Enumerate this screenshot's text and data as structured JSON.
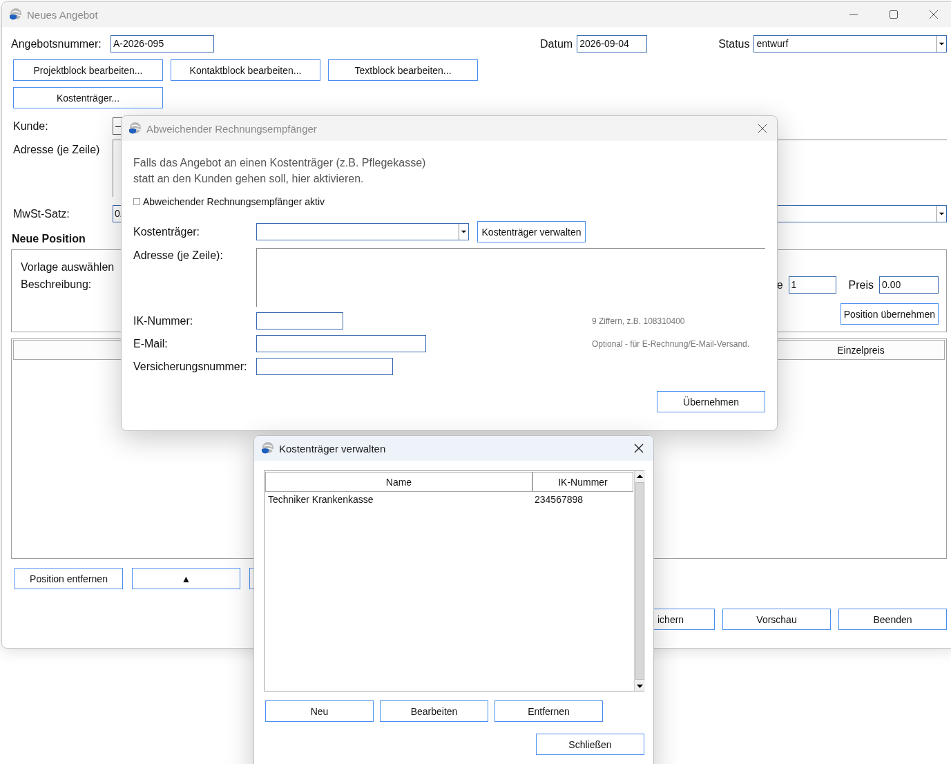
{
  "main_window": {
    "title": "Neues Angebot",
    "active": false,
    "header": {
      "number_label": "Angebotsnummer:",
      "number_value": "A-2026-095",
      "date_label": "Datum",
      "date_value": "2026-09-04",
      "status_label": "Status",
      "status_value": "entwurf"
    },
    "block_buttons": [
      "Projektblock bearbeiten...",
      "Kontaktblock bearbeiten...",
      "Textblock bearbeiten..."
    ],
    "cost_button": "Kostenträger...",
    "customer_label": "Kunde:",
    "customer_value": "—",
    "address_label": "Adresse (je Zeile)",
    "vat_label": "MwSt-Satz:",
    "vat_value": "0.",
    "new_position": {
      "heading": "Neue Position",
      "template_label": "Vorlage auswählen",
      "description_label": "Beschreibung:",
      "quantity_label": "e",
      "quantity_value": "1",
      "price_label": "Preis",
      "price_value": "0.00",
      "apply_button": "Position übernehmen"
    },
    "positions_table": {
      "visible_column": "Einzelpreis"
    },
    "row_buttons": [
      "Position entfernen",
      "▲"
    ],
    "footer_buttons": [
      "ichern",
      "Vorschau",
      "Beenden"
    ]
  },
  "recipient_dialog": {
    "title": "Abweichender Rechnungsempfänger",
    "active": false,
    "intro_lines": [
      "Falls das Angebot an einen Kostenträger (z.B. Pflegekasse)",
      "statt an den Kunden gehen soll, hier aktivieren."
    ],
    "checkbox": {
      "label": "Abweichender Rechnungsempfänger aktiv",
      "checked": false
    },
    "payer_label": "Kostenträger:",
    "manage_button": "Kostenträger verwalten",
    "address_label": "Adresse (je Zeile):",
    "fields": [
      {
        "label": "IK-Nummer:",
        "hint": "9 Ziffern, z.B. 108310400"
      },
      {
        "label": "E-Mail:",
        "hint": "Optional - für E-Rechnung/E-Mail-Versand."
      },
      {
        "label": "Versicherungsnummer:"
      }
    ],
    "apply_button": "Übernehmen"
  },
  "payers_dialog": {
    "title": "Kostenträger verwalten",
    "active": true,
    "columns": [
      "Name",
      "IK-Nummer"
    ],
    "rows": [
      [
        "Techniker Krankenkasse",
        "234567898"
      ]
    ],
    "buttons": [
      "Neu",
      "Bearbeiten",
      "Entfernen"
    ],
    "close_button": "Schließen"
  }
}
